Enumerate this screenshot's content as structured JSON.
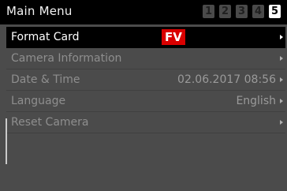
{
  "header": {
    "title": "Main Menu",
    "page_tabs": [
      "1",
      "2",
      "3",
      "4",
      "5"
    ],
    "active_page": "5"
  },
  "menu": {
    "items": [
      {
        "label": "Format Card",
        "value": "",
        "badge": "FV",
        "selected": true
      },
      {
        "label": "Camera Information",
        "value": "",
        "badge": "",
        "selected": false
      },
      {
        "label": "Date & Time",
        "value": "02.06.2017 08:56",
        "badge": "",
        "selected": false
      },
      {
        "label": "Language",
        "value": "English",
        "badge": "",
        "selected": false
      },
      {
        "label": "Reset Camera",
        "value": "",
        "badge": "",
        "selected": false
      }
    ]
  },
  "colors": {
    "background": "#4b4b4b",
    "header": "#000000",
    "selected_row": "#000000",
    "badge": "#d90000",
    "active_tab": "#ffffff"
  }
}
